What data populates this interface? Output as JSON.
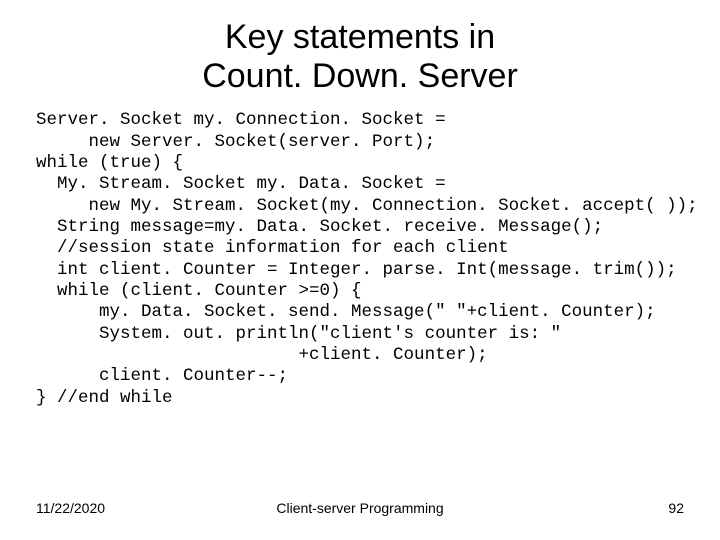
{
  "title_line1": "Key statements in",
  "title_line2": "Count. Down. Server",
  "code": "Server. Socket my. Connection. Socket =\n     new Server. Socket(server. Port);\nwhile (true) {\n  My. Stream. Socket my. Data. Socket =\n     new My. Stream. Socket(my. Connection. Socket. accept( ));\n  String message=my. Data. Socket. receive. Message();\n  //session state information for each client\n  int client. Counter = Integer. parse. Int(message. trim());\n  while (client. Counter >=0) {\n      my. Data. Socket. send. Message(\" \"+client. Counter);\n      System. out. println(\"client's counter is: \"\n                         +client. Counter);\n      client. Counter--;\n} //end while",
  "footer": {
    "date": "11/22/2020",
    "center": "Client-server Programming",
    "page": "92"
  }
}
